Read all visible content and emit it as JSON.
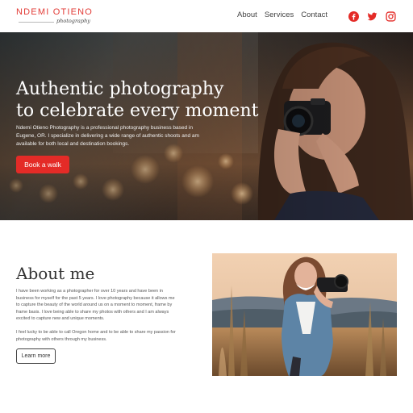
{
  "header": {
    "logo_name": "NDEMI OTIENO",
    "logo_sub": "photography",
    "nav": [
      "About",
      "Services",
      "Contact"
    ],
    "social_icons": [
      "facebook-icon",
      "twitter-icon",
      "instagram-icon"
    ]
  },
  "hero": {
    "title_line1": "Authentic photography",
    "title_line2": "to celebrate every moment",
    "description": "Ndemi Otieno Photography is a professional photography business based in Eugene, OR. I specialize in delivering a wide range of authentic shoots and am available for both local and destination bookings.",
    "cta_label": "Book a walk"
  },
  "about": {
    "title": "About me",
    "p1": "I have been working as a photographer for over 10 years and have been in business for myself for the past 5 years. I love photography because it allows me to capture the beauty of the world around us on a moment to moment, frame by frame basis. I love being able to share my photos with others and I am always excited to capture new and unique moments.",
    "p2": "I feel lucky to be able to call Oregon home and to be able to share my passion for photography with others through my business.",
    "cta_label": "Learn more"
  },
  "colors": {
    "accent": "#e42b27",
    "logo": "#e23a35"
  }
}
